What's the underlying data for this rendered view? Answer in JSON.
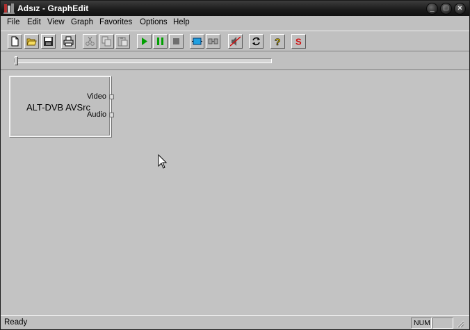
{
  "window": {
    "title": "Adsız - GraphEdit",
    "icon": "graphedit-app-icon"
  },
  "titlebar_buttons": {
    "minimize": "_",
    "maximize": "□",
    "close": "×"
  },
  "menu": {
    "items": [
      {
        "label": "File"
      },
      {
        "label": "Edit"
      },
      {
        "label": "View"
      },
      {
        "label": "Graph"
      },
      {
        "label": "Favorites"
      },
      {
        "label": "Options"
      },
      {
        "label": "Help"
      }
    ]
  },
  "toolbar": {
    "buttons": [
      {
        "icon": "new-file-icon"
      },
      {
        "icon": "open-folder-icon"
      },
      {
        "icon": "save-icon"
      },
      {
        "icon": "print-icon"
      },
      {
        "icon": "cut-icon"
      },
      {
        "icon": "copy-icon"
      },
      {
        "icon": "paste-icon"
      },
      {
        "icon": "play-icon"
      },
      {
        "icon": "pause-icon"
      },
      {
        "icon": "stop-icon"
      },
      {
        "icon": "insert-filter-icon"
      },
      {
        "icon": "connect-icon"
      },
      {
        "icon": "mute-icon"
      },
      {
        "icon": "refresh-icon"
      },
      {
        "icon": "help-icon"
      },
      {
        "icon": "seek-s-icon",
        "label": "S"
      }
    ]
  },
  "seekbar": {
    "position": 0
  },
  "filter": {
    "name": "ALT-DVB AVSrc",
    "pins": {
      "video": "Video",
      "audio": "Audio"
    }
  },
  "status": {
    "text": "Ready",
    "num_indicator": "NUM"
  },
  "colors": {
    "titlebar": "#1d1d1d",
    "face": "#c0c0c0",
    "canvas": "#c3c3c3",
    "play_green": "#00a000",
    "stop_red": "#d01010"
  }
}
